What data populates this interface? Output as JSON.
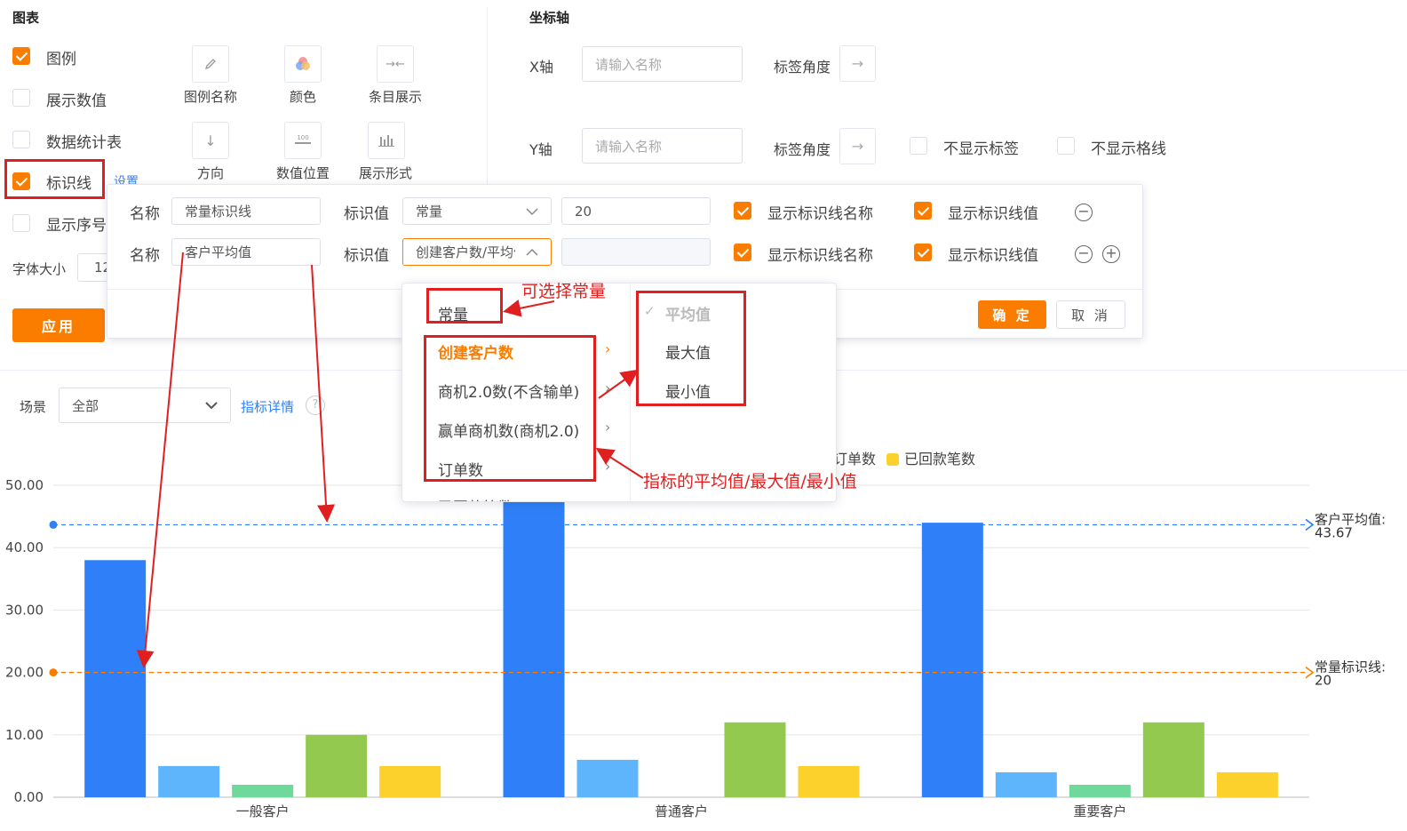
{
  "chart_section": {
    "title": "图表",
    "options": [
      {
        "label": "图例",
        "checked": true
      },
      {
        "label": "展示数值",
        "checked": false
      },
      {
        "label": "数据统计表",
        "checked": false
      },
      {
        "label": "标识线",
        "checked": true
      },
      {
        "label": "显示序号",
        "checked": false
      }
    ],
    "settings_link": "设置",
    "tools": [
      {
        "label": "图例名称",
        "icon": "pencil-icon"
      },
      {
        "label": "颜色",
        "icon": "color-palette-icon"
      },
      {
        "label": "条目展示",
        "icon": "collapse-arrows-icon"
      },
      {
        "label": "方向",
        "icon": "arrow-down-icon"
      },
      {
        "label": "数值位置",
        "icon": "value-position-icon"
      },
      {
        "label": "展示形式",
        "icon": "bar-chart-icon"
      }
    ],
    "font_size_label": "字体大小",
    "font_size_value": "12",
    "apply_button": "应用"
  },
  "axis_section": {
    "title": "坐标轴",
    "x_label": "X轴",
    "x_placeholder": "请输入名称",
    "x_angle_label": "标签角度",
    "y_label": "Y轴",
    "y_placeholder": "请输入名称",
    "y_angle_label": "标签角度",
    "hide_labels": "不显示标签",
    "hide_gridlines": "不显示格线"
  },
  "refline_popover": {
    "rows": [
      {
        "name_label": "名称",
        "name_value": "常量标识线",
        "value_label": "标识值",
        "type_value": "常量",
        "constant_value": "20",
        "show_name": "显示标识线名称",
        "show_value": "显示标识线值"
      },
      {
        "name_label": "名称",
        "name_value": "客户平均值",
        "value_label": "标识值",
        "type_value": "创建客户数/平均值",
        "constant_value": "",
        "show_name": "显示标识线名称",
        "show_value": "显示标识线值"
      }
    ],
    "confirm_button": "确 定",
    "cancel_button": "取 消"
  },
  "dropdown": {
    "items": [
      "常量",
      "创建客户数",
      "商机2.0数(不含输单)",
      "赢单商机数(商机2.0)",
      "订单数",
      "已回款笔数"
    ],
    "active_item": "创建客户数",
    "sub_items": [
      "平均值",
      "最大值",
      "最小值"
    ],
    "selected_sub_item": "平均值"
  },
  "annotations": {
    "constant": "可选择常量",
    "metric": "指标的平均值/最大值/最小值"
  },
  "filter_bar": {
    "scene_label": "场景",
    "scene_value": "全部",
    "metric_detail_link": "指标详情",
    "help_icon": "?"
  },
  "chart_data": {
    "type": "bar",
    "categories": [
      "一般客户",
      "普通客户",
      "重要客户"
    ],
    "series": [
      {
        "name": "创建客户数",
        "color": "#2f80f8",
        "values": [
          38,
          47.5,
          44
        ]
      },
      {
        "name": "商机2.0数(不含输单)",
        "color": "#5eb5fc",
        "values": [
          5,
          6,
          4
        ]
      },
      {
        "name": "赢单商机数(商机2.0)",
        "color": "#6ed99a",
        "values": [
          2,
          0,
          2
        ]
      },
      {
        "name": "订单数",
        "color": "#93c94f",
        "values": [
          10,
          12,
          12
        ]
      },
      {
        "name": "已回款笔数",
        "color": "#fdd12c",
        "values": [
          5,
          5,
          4
        ]
      }
    ],
    "visible_legend": [
      {
        "name": "订单数",
        "color": "#93c94f"
      },
      {
        "name": "已回款笔数",
        "color": "#fdd12c"
      }
    ],
    "yticks": [
      "0.00",
      "10.00",
      "20.00",
      "30.00",
      "40.00",
      "50.00"
    ],
    "ylim": [
      0,
      50
    ],
    "reference_lines": [
      {
        "name": "客户平均值",
        "value": 43.67,
        "label": "客户平均值:",
        "value_label": "43.67",
        "color": "#2f80f8"
      },
      {
        "name": "常量标识线",
        "value": 20,
        "label": "常量标识线:",
        "value_label": "20",
        "color": "#fa7d00"
      }
    ],
    "grid": true
  },
  "colors": {
    "accent": "#fa7d00",
    "link": "#2f80f8",
    "annotation_red": "#e02020"
  }
}
